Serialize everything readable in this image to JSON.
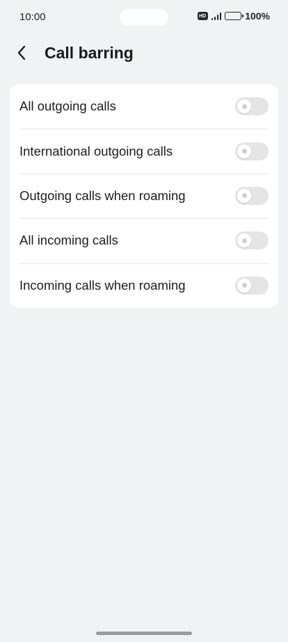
{
  "status_bar": {
    "time": "10:00",
    "hd_label": "HD",
    "battery_text": "100%"
  },
  "header": {
    "title": "Call barring",
    "back_icon": "chevron-left-icon"
  },
  "settings": {
    "items": [
      {
        "label": "All outgoing calls",
        "enabled": false
      },
      {
        "label": "International outgoing calls",
        "enabled": false
      },
      {
        "label": "Outgoing calls when roaming",
        "enabled": false
      },
      {
        "label": "All incoming calls",
        "enabled": false
      },
      {
        "label": "Incoming calls when roaming",
        "enabled": false
      }
    ]
  },
  "colors": {
    "background": "#f1f2f4",
    "card": "#ffffff",
    "toggle_off": "#e5e5e7"
  }
}
